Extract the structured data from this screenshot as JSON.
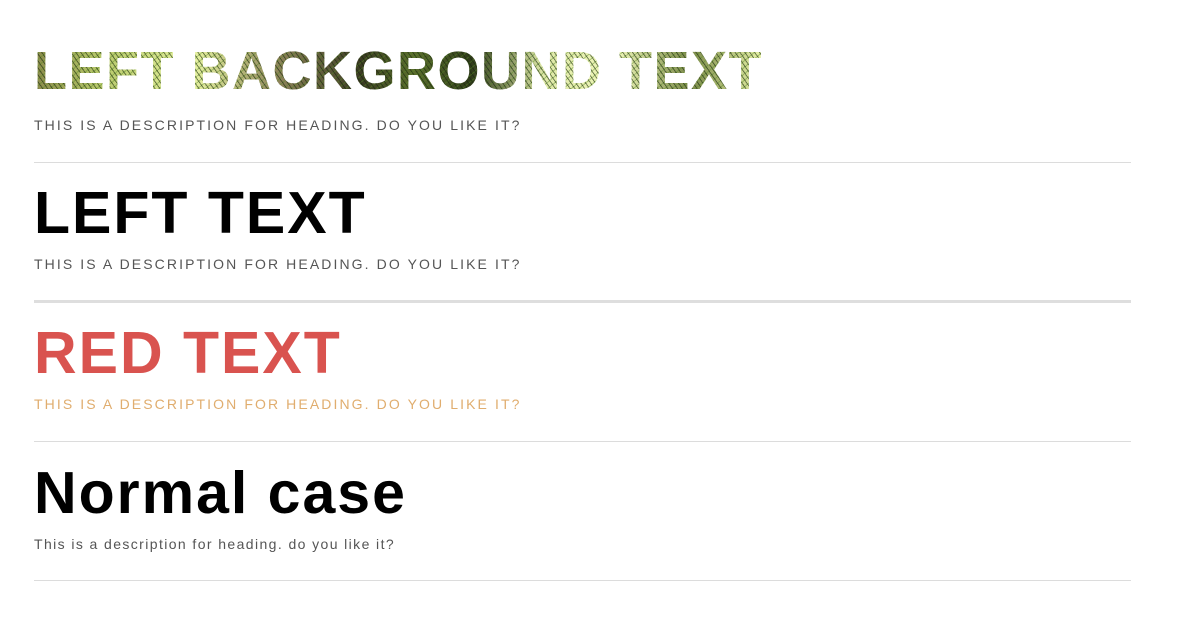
{
  "sections": [
    {
      "heading": "LEFT BACKGROUND TEXT",
      "description": "THIS IS A DESCRIPTION FOR HEADING. DO YOU LIKE IT?",
      "style": "background-image-text"
    },
    {
      "heading": "LEFT TEXT",
      "description": "THIS IS A DESCRIPTION FOR HEADING. DO YOU LIKE IT?",
      "style": "plain"
    },
    {
      "heading": "RED TEXT",
      "description": "THIS IS A DESCRIPTION FOR HEADING. DO YOU LIKE IT?",
      "style": "colored",
      "heading_color": "#d9534f",
      "description_color": "#e0ad6e"
    },
    {
      "heading": "Normal case",
      "description": "This is a description for heading. do you like it?",
      "style": "normal-case"
    }
  ],
  "colors": {
    "background": "#ffffff",
    "divider": "#dcdcdc",
    "description": "#555555"
  }
}
